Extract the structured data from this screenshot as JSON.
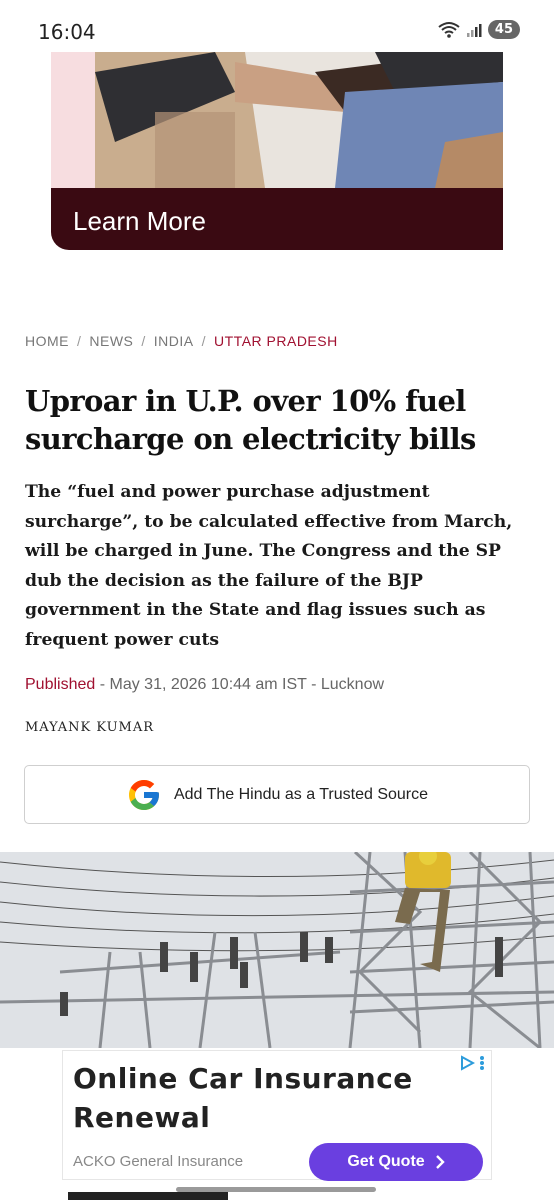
{
  "status_bar": {
    "time": "16:04",
    "battery": "45",
    "wifi_icon": "wifi-icon",
    "signal_icon": "signal-icon"
  },
  "top_ad": {
    "cta_label": "Learn More"
  },
  "breadcrumb": {
    "items": [
      "HOME",
      "NEWS",
      "INDIA",
      "UTTAR PRADESH"
    ],
    "separator": "/"
  },
  "article": {
    "headline": "Uproar in U.P. over 10% fuel surcharge on electricity bills",
    "summary": "The “fuel and power purchase adjustment surcharge”, to be calculated effective from March, will be charged in June. The Congress and the SP dub the decision as the failure of the BJP government in the State and flag issues such as frequent power cuts",
    "published_label": "Published",
    "published_rest": " - May 31, 2026 10:44 am IST - Lucknow",
    "author": "MAYANK KUMAR"
  },
  "trusted_source": {
    "label": "Add The Hindu as a Trusted Source",
    "icon": "google-g-icon"
  },
  "bottom_ad": {
    "title": "Online Car Insurance Renewal",
    "advertiser": "ACKO General Insurance",
    "cta_label": "Get Quote",
    "cta_icon": "chevron-right-icon"
  },
  "colors": {
    "accent_red": "#a01030",
    "ad_maroon": "#3a0a12",
    "cta_purple": "#6a3fe0"
  }
}
